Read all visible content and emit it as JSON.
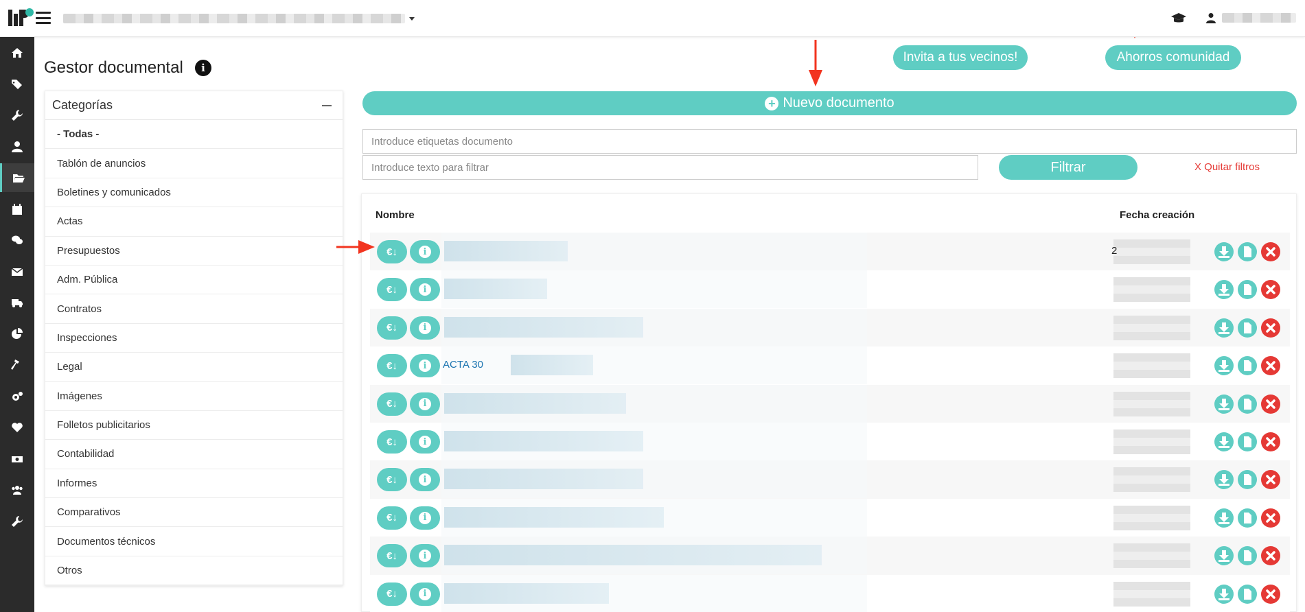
{
  "header": {
    "community_name": "",
    "user_name": "",
    "icons": [
      "menu-icon",
      "graduation-cap-icon",
      "user-icon"
    ]
  },
  "sidebar": {
    "items": [
      {
        "icon": "home-icon"
      },
      {
        "icon": "tags-icon"
      },
      {
        "icon": "wrench-icon"
      },
      {
        "icon": "user-tie-icon"
      },
      {
        "icon": "folder-open-icon",
        "active": true
      },
      {
        "icon": "calendar-icon"
      },
      {
        "icon": "comments-icon"
      },
      {
        "icon": "envelope-icon"
      },
      {
        "icon": "truck-icon"
      },
      {
        "icon": "pie-chart-icon"
      },
      {
        "icon": "hammer-icon"
      },
      {
        "icon": "cogs-icon"
      },
      {
        "icon": "heart-icon"
      },
      {
        "icon": "money-icon"
      },
      {
        "icon": "users-icon"
      },
      {
        "icon": "wrench-icon"
      }
    ]
  },
  "page": {
    "title": "Gestor documental",
    "invite_button": "Invita a tus vecinos!",
    "savings_button": "Ahorros comunidad",
    "new_document_button": "Nuevo documento"
  },
  "categories": {
    "title": "Categorías",
    "items": [
      "- Todas -",
      "Tablón de anuncios",
      "Boletines y comunicados",
      "Actas",
      "Presupuestos",
      "Adm. Pública",
      "Contratos",
      "Inspecciones",
      "Legal",
      "Imágenes",
      "Folletos publicitarios",
      "Contabilidad",
      "Informes",
      "Comparativos",
      "Documentos técnicos",
      "Otros"
    ]
  },
  "filters": {
    "tags_placeholder": "Introduce etiquetas documento",
    "text_placeholder": "Introduce texto para filtrar",
    "filter_button": "Filtrar",
    "clear_filters": "X Quitar filtros"
  },
  "table": {
    "columns": {
      "name": "Nombre",
      "date": "Fecha creación"
    },
    "rows": [
      {
        "name": "",
        "date": "2"
      },
      {
        "name": "",
        "date": ""
      },
      {
        "name": "",
        "date": ""
      },
      {
        "name": "ACTA 30",
        "date": ""
      },
      {
        "name": "",
        "date": ""
      },
      {
        "name": "",
        "date": ""
      },
      {
        "name": "",
        "date": ""
      },
      {
        "name": "",
        "date": ""
      },
      {
        "name": "",
        "date": ""
      },
      {
        "name": "",
        "date": ""
      }
    ],
    "euro_button_label": "€↓"
  },
  "colors": {
    "accent": "#5fcdc3",
    "sidebar_bg": "#2b2b2b",
    "link": "#1a73b0",
    "danger": "#e53935",
    "annotation_arrow": "#f2341f"
  }
}
